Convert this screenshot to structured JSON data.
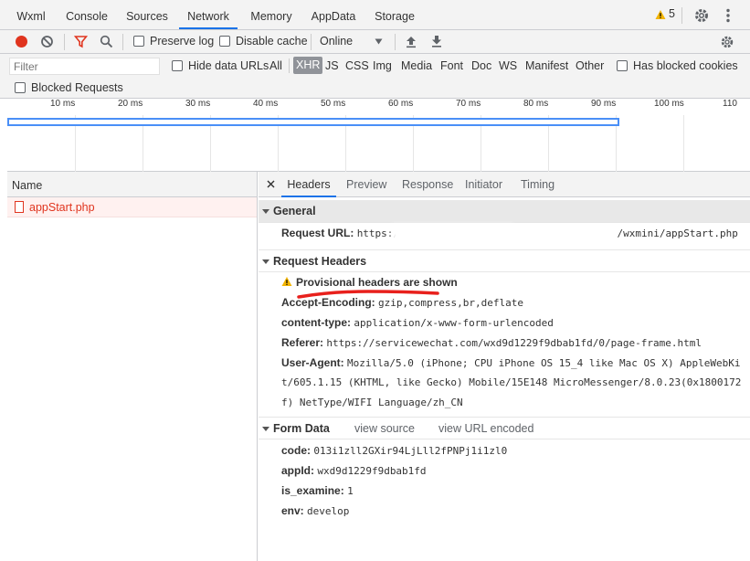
{
  "tabs": [
    "Wxml",
    "Console",
    "Sources",
    "Network",
    "Memory",
    "AppData",
    "Storage"
  ],
  "warnings_count": "5",
  "toolbar": {
    "preserve_log": "Preserve log",
    "disable_cache": "Disable cache",
    "throttle": "Online"
  },
  "filter": {
    "placeholder": "Filter",
    "hide_data_urls": "Hide data URLs",
    "types": [
      "All",
      "XHR",
      "JS",
      "CSS",
      "Img",
      "Media",
      "Font",
      "Doc",
      "WS",
      "Manifest",
      "Other"
    ],
    "active_type": "XHR",
    "has_blocked_cookies": "Has blocked cookies",
    "blocked_requests": "Blocked Requests"
  },
  "timeline": {
    "ticks": [
      "10 ms",
      "20 ms",
      "30 ms",
      "40 ms",
      "50 ms",
      "60 ms",
      "70 ms",
      "80 ms",
      "90 ms",
      "100 ms",
      "110"
    ]
  },
  "requests": {
    "header": "Name",
    "items": [
      "appStart.php"
    ]
  },
  "details": {
    "tabs": [
      "Headers",
      "Preview",
      "Response",
      "Initiator",
      "Timing"
    ],
    "general": {
      "title": "General",
      "request_url_label": "Request URL:",
      "request_url_value": "https://                                   /wxmini/appStart.php"
    },
    "request_headers": {
      "title": "Request Headers",
      "provisional": "Provisional headers are shown",
      "rows": [
        {
          "k": "Accept-Encoding:",
          "v": "gzip,compress,br,deflate"
        },
        {
          "k": "content-type:",
          "v": "application/x-www-form-urlencoded"
        },
        {
          "k": "Referer:",
          "v": "https://servicewechat.com/wxd9d1229f9dbab1fd/0/page-frame.html"
        },
        {
          "k": "User-Agent:",
          "v": "Mozilla/5.0 (iPhone; CPU iPhone OS 15_4 like Mac OS X) AppleWebKi"
        }
      ],
      "ua_line2": "t/605.1.15 (KHTML, like Gecko) Mobile/15E148 MicroMessenger/8.0.23(0x1800172",
      "ua_line3": "f) NetType/WIFI Language/zh_CN"
    },
    "form_data": {
      "title": "Form Data",
      "view_source": "view source",
      "view_url_encoded": "view URL encoded",
      "rows": [
        {
          "k": "code:",
          "v": "013i1zll2GXir94LjLll2fPNPj1i1zl0"
        },
        {
          "k": "appId:",
          "v": "wxd9d1229f9dbab1fd"
        },
        {
          "k": "is_examine:",
          "v": "1"
        },
        {
          "k": "env:",
          "v": "develop"
        }
      ]
    }
  },
  "colors": {
    "accent": "#1a73e8",
    "record": "#e0341e",
    "warning": "#f2b400"
  }
}
